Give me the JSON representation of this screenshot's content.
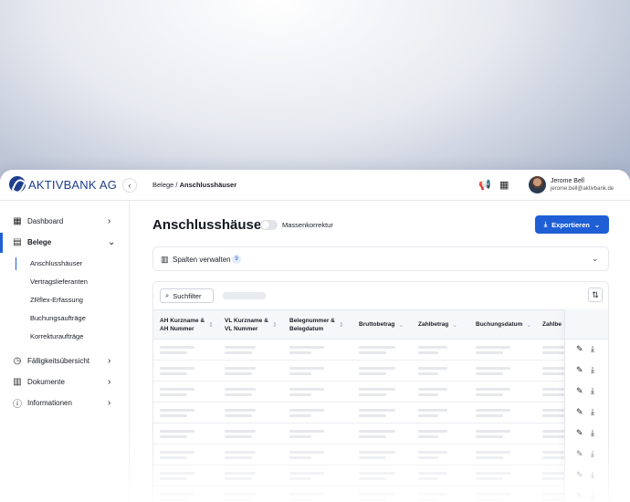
{
  "brand": {
    "name": "AKTIVBANK AG",
    "color": "#1f3f8c",
    "accent": "#1f5fd6"
  },
  "header": {
    "collapse_icon": "chevron-left-icon",
    "collapse_glyph": "‹",
    "breadcrumb_parent": "Belege /",
    "breadcrumb_current": "Anschlusshäuser",
    "announce_glyph": "📢",
    "calendar_glyph": "▦",
    "user": {
      "name": "Jerome Bell",
      "email": "jerome.bell@aktivbank.de"
    }
  },
  "sidebar": {
    "items": [
      {
        "label": "Dashboard",
        "icon": "grid-icon",
        "glyph": "▦",
        "chevron": "›"
      },
      {
        "label": "Belege",
        "icon": "receipt-icon",
        "glyph": "▤",
        "chevron": "⌄"
      },
      {
        "label": "Fälligkeitsübersicht",
        "icon": "clock-icon",
        "glyph": "◷",
        "chevron": "›"
      },
      {
        "label": "Dokumente",
        "icon": "document-icon",
        "glyph": "▥",
        "chevron": "›"
      },
      {
        "label": "Informationen",
        "icon": "info-icon",
        "glyph": "ⓘ",
        "chevron": "›"
      }
    ],
    "sub_items": [
      "Anschlusshäuser",
      "Vertragslieferanten",
      "ZRflex-Erfassung",
      "Buchungsaufträge",
      "Korrekturaufträge"
    ]
  },
  "main": {
    "title": "Anschlusshäuser",
    "toggle_label": "Massenkorrektur",
    "export_label": "Exportieren",
    "export_icon": "⤓",
    "export_chevron": "⌄",
    "columns_label": "Spalten verwalten",
    "columns_count": "9",
    "columns_chevron": "⌄",
    "search_label": "Suchfilter",
    "search_icon": "⌕",
    "sort_glyph": "⇅",
    "table_headers": [
      {
        "l1": "AH Kurzname &",
        "l2": "AH Nummer"
      },
      {
        "l1": "VL Kurzname &",
        "l2": "VL Nummer"
      },
      {
        "l1": "Belegnummer &",
        "l2": "Belegdatum"
      },
      {
        "l1": "Bruttobetrag",
        "l2": ""
      },
      {
        "l1": "Zahlbetrag",
        "l2": ""
      },
      {
        "l1": "Buchungsdatum",
        "l2": ""
      },
      {
        "l1": "Zahlbe",
        "l2": ""
      }
    ],
    "row_actions": {
      "edit": "✎",
      "download": "⤓"
    }
  }
}
